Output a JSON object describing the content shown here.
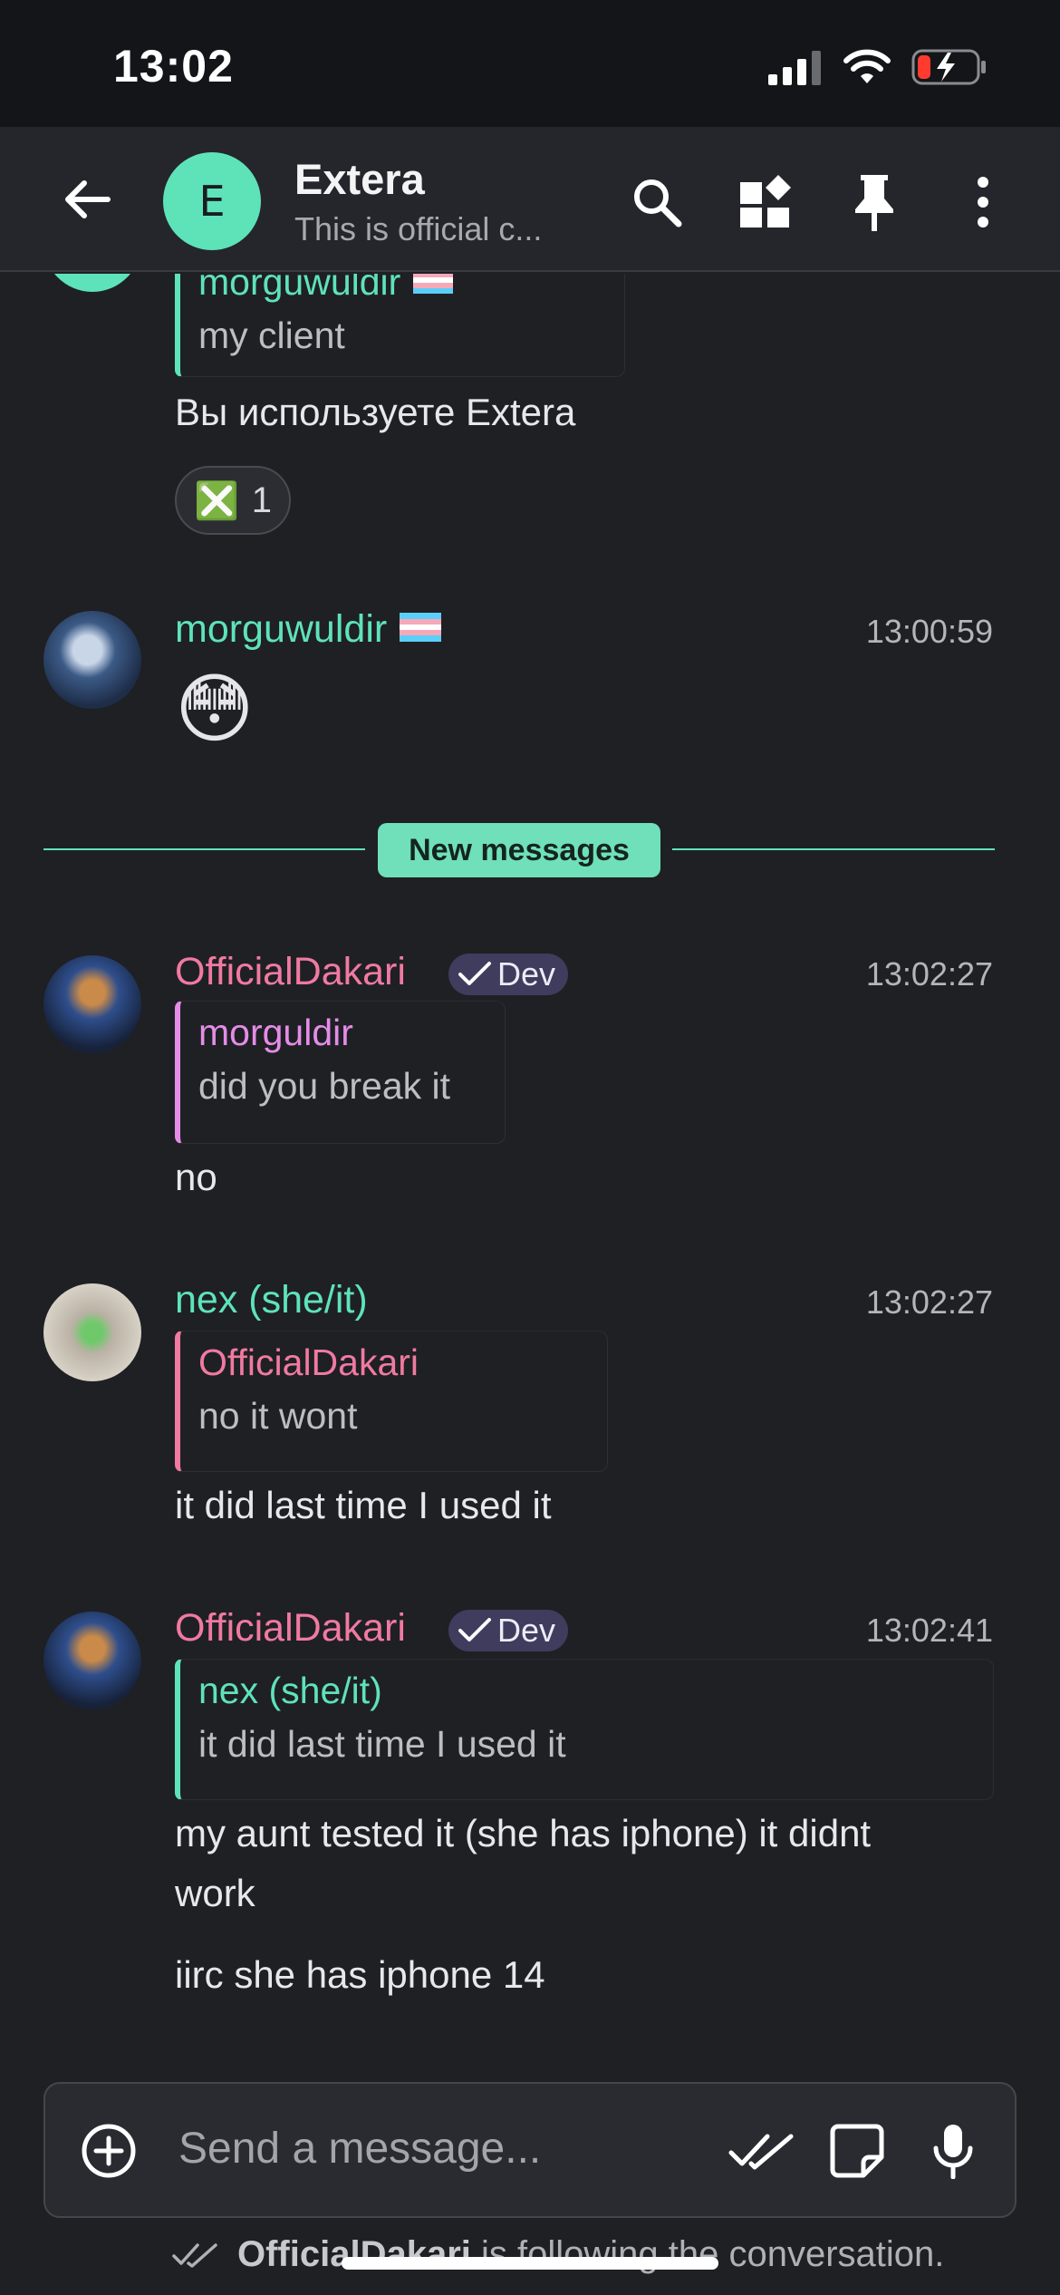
{
  "status_bar": {
    "time": "13:02"
  },
  "header": {
    "avatar_letter": "E",
    "title": "Extera",
    "subtitle": "This is official c..."
  },
  "messages": {
    "msg0": {
      "reply_author": "morguwuldir",
      "reply_text": "my client",
      "body": "Вы используете Extera",
      "reaction": {
        "emoji": "❎",
        "count": "1"
      }
    },
    "msg1": {
      "author": "morguwuldir",
      "time": "13:00:59",
      "emoji": "😳"
    },
    "new_messages_label": "New messages",
    "msg2": {
      "author": "OfficialDakari",
      "badge": "Dev",
      "time": "13:02:27",
      "reply_author": "morguldir",
      "reply_text": "did you break it",
      "body": "no"
    },
    "msg3": {
      "author": "nex (she/it)",
      "time": "13:02:27",
      "reply_author": "OfficialDakari",
      "reply_text": "no it wont",
      "body": "it did last time I used it"
    },
    "msg4": {
      "author": "OfficialDakari",
      "badge": "Dev",
      "time": "13:02:41",
      "reply_author": "nex (she/it)",
      "reply_text": "it did last time I used it",
      "body1_line1": "my aunt tested it (she has iphone) it didnt",
      "body1_line2": "work",
      "body2": "iirc she has iphone 14"
    }
  },
  "composer": {
    "placeholder": "Send a message...",
    "typing_user": "OfficialDakari",
    "typing_suffix": "is following the conversation."
  },
  "colors": {
    "accent": "#5ee3b9",
    "pink": "#f07aa0",
    "magenta": "#e58ce8",
    "background": "#1f2024",
    "header": "#25262b"
  }
}
